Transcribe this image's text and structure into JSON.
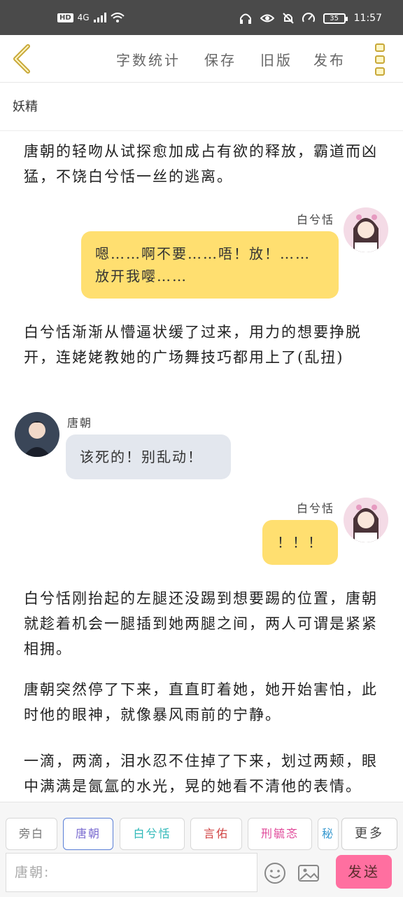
{
  "status_bar": {
    "network": "HD",
    "signal": "4G",
    "battery": "35",
    "time": "11:57",
    "icons": [
      "headphones-icon",
      "eye-icon",
      "bell-off-icon",
      "speed-icon",
      "battery-icon"
    ]
  },
  "toolbar": {
    "back_icon": "chevron-left-icon",
    "items": [
      "字数统计",
      "保存",
      "旧版",
      "发布"
    ],
    "more_icon": "more-vertical-icon",
    "accent": "#c8a838"
  },
  "document": {
    "title": "妖精"
  },
  "story": {
    "para1": "唐朝的轻吻从试探愈加成占有欲的释放，霸道而凶猛，不饶白兮恬一丝的逃离。",
    "msg1": {
      "speaker": "白兮恬",
      "text": "嗯……啊不要……唔！放！……放开我嘤……"
    },
    "para2": "白兮恬渐渐从懵逼状缓了过来，用力的想要挣脱开，连姥姥教她的广场舞技巧都用上了(乱扭)",
    "msg2": {
      "speaker": "唐朝",
      "text": "该死的！别乱动！"
    },
    "msg3": {
      "speaker": "白兮恬",
      "text": "！！！"
    },
    "para3": "白兮恬刚抬起的左腿还没踢到想要踢的位置，唐朝就趁着机会一腿插到她两腿之间，两人可谓是紧紧相拥。",
    "para4": "唐朝突然停了下来，直直盯着她，她开始害怕，此时他的眼神，就像暴风雨前的宁静。",
    "para5": "一滴，两滴，泪水忍不住掉了下来，划过两颊，眼中满满是氤氲的水光，晃的她看不清他的表情。"
  },
  "roles": {
    "chips": [
      {
        "label": "旁白",
        "color": "#777777"
      },
      {
        "label": "唐朝",
        "color": "#7a6bd0"
      },
      {
        "label": "白兮恬",
        "color": "#2fb8b8"
      },
      {
        "label": "言佑",
        "color": "#d04040"
      },
      {
        "label": "刑毓忞",
        "color": "#e04a9a"
      },
      {
        "label": "秘",
        "color": "#3a9ad0"
      }
    ],
    "more_label": "更多"
  },
  "composer": {
    "placeholder": "唐朝:",
    "emoji_icon": "smiley-icon",
    "image_icon": "image-icon",
    "send_label": "发送",
    "send_color": "#ff6fa0"
  }
}
